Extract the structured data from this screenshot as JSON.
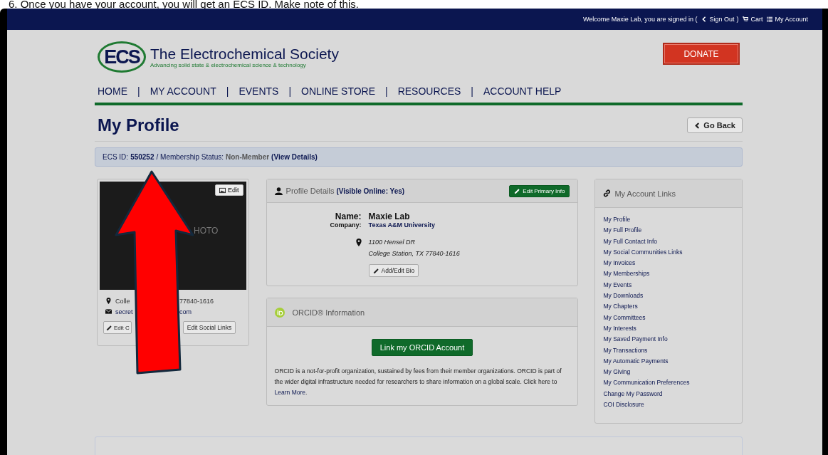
{
  "caption": "6. Once you have your account, you will get an ECS ID. Make note of this.",
  "top_bar": {
    "welcome": "Welcome Maxie Lab, you are signed in (",
    "sign_out": "Sign Out",
    "close": ")",
    "cart": "Cart",
    "my_account": "My Account"
  },
  "header": {
    "logo_text": "ECS",
    "title": "The Electrochemical Society",
    "tagline": "Advancing solid state & electrochemical science & technology",
    "donate": "DONATE"
  },
  "nav": [
    {
      "label": "HOME",
      "separator": "|"
    },
    {
      "label": "MY ACCOUNT",
      "separator": "|"
    },
    {
      "label": "EVENTS",
      "separator": "|"
    },
    {
      "label": "ONLINE STORE",
      "separator": "|"
    },
    {
      "label": "RESOURCES",
      "separator": "|"
    },
    {
      "label": "ACCOUNT HELP"
    }
  ],
  "page_title": "My Profile",
  "go_back": "Go Back",
  "id_bar": {
    "id_label": "ECS ID:",
    "id_value": "550252",
    "status_label": "/ Membership Status:",
    "status_value": "Non-Member",
    "details": "(View Details)"
  },
  "photo_card": {
    "photo_text": "HOTO",
    "edit": "Edit",
    "address_parts": [
      "Colle",
      "77840-1616"
    ],
    "email_parts": [
      "secret",
      "com"
    ],
    "buttons": [
      "Edit C",
      "Edit Social Links"
    ]
  },
  "profile": {
    "title": "Profile Details",
    "visibility": "(Visible Online: Yes)",
    "edit_primary": "Edit Primary Info",
    "fields": [
      {
        "label": "Name:",
        "value": "Maxie Lab",
        "kind": "name"
      },
      {
        "label": "Company:",
        "value": "Texas A&M University",
        "kind": "link"
      }
    ],
    "address": [
      "1100 Hensel DR",
      "College Station, TX 77840-1616"
    ],
    "bio_button": "Add/Edit Bio"
  },
  "orcid": {
    "title": "ORCID® Information",
    "button": "Link my ORCID Account",
    "text": "ORCID is a not-for-profit organization, sustained by fees from their member organizations. ORCID is part of the wider digital infrastructure needed for researchers to share information on a global scale. Click here to",
    "link": "Learn More",
    "end": "."
  },
  "links": {
    "title": "My Account Links",
    "items": [
      "My Profile",
      "My Full Profile",
      "My Full Contact Info",
      "My Social Communities Links",
      "My Invoices",
      "My Memberships",
      "My Events",
      "My Downloads",
      "My Chapters",
      "My Committees",
      "My Interests",
      "My Saved Payment Info",
      "My Transactions",
      "My Automatic Payments",
      "My Giving",
      "My Communication Preferences",
      "Change My Password",
      "COI Disclosure"
    ]
  }
}
